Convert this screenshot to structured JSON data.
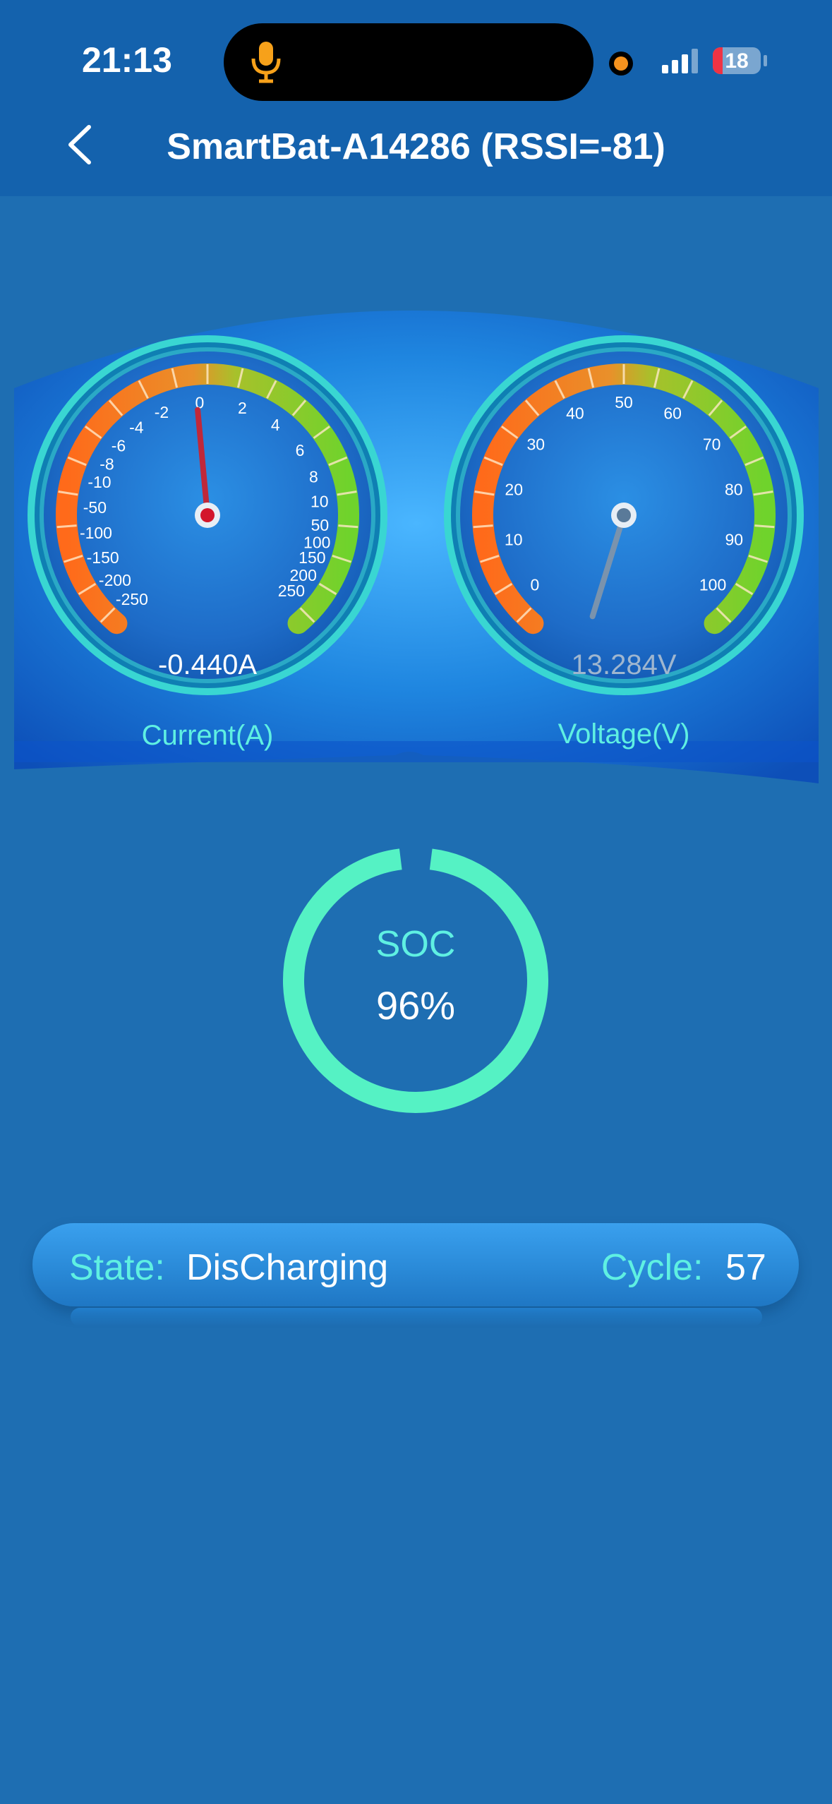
{
  "status_bar": {
    "time": "21:13",
    "battery_level": "18"
  },
  "header": {
    "title": "SmartBat-A14286 (RSSI=-81)"
  },
  "current_gauge": {
    "label": "Current(A)",
    "readout": "-0.440A",
    "value": -0.44,
    "ticks": [
      "-250",
      "-200",
      "-150",
      "-100",
      "-50",
      "-10",
      "-8",
      "-6",
      "-4",
      "-2",
      "0",
      "2",
      "4",
      "6",
      "8",
      "10",
      "50",
      "100",
      "150",
      "200",
      "250"
    ]
  },
  "voltage_gauge": {
    "label": "Voltage(V)",
    "readout": "13.284V",
    "value": 13.284,
    "ticks": [
      "0",
      "10",
      "20",
      "30",
      "40",
      "50",
      "60",
      "70",
      "80",
      "90",
      "100"
    ]
  },
  "soc": {
    "label": "SOC",
    "value_text": "96%",
    "percent": 96
  },
  "state_bar": {
    "state_label": "State:",
    "state_value": "DisCharging",
    "cycle_label": "Cycle:",
    "cycle_value": "57"
  },
  "colors": {
    "accent": "#5ff0e2",
    "soc_ring": "#55f2c4",
    "background": "#1e6eb2",
    "header": "#1462ad"
  }
}
